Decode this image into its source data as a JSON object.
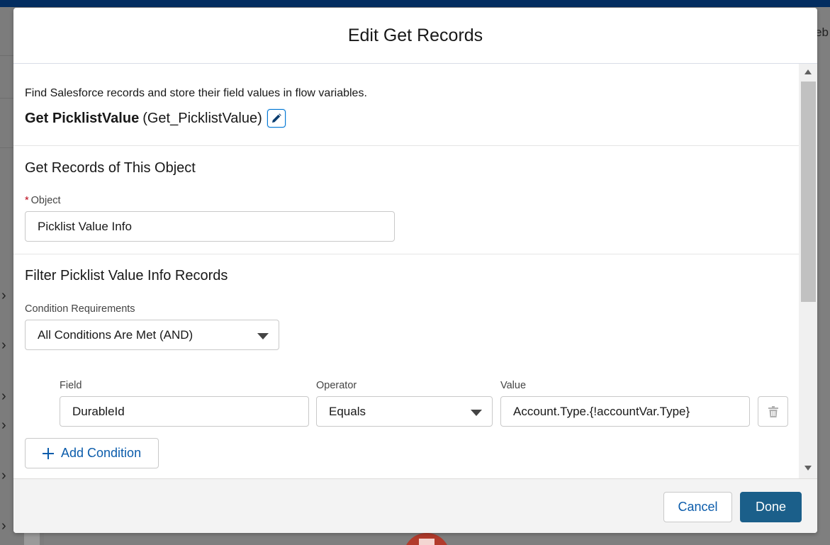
{
  "background": {
    "tab_text": "eb"
  },
  "modal": {
    "title": "Edit Get Records",
    "description": "Find Salesforce records and store their field values in flow variables.",
    "element_label": "Get PicklistValue",
    "element_api_name": "(Get_PicklistValue)",
    "object_section": {
      "title": "Get Records of This Object",
      "required_mark": "*",
      "object_label": "Object",
      "object_value": "Picklist Value Info"
    },
    "filter_section": {
      "title": "Filter Picklist Value Info Records",
      "condition_requirements_label": "Condition Requirements",
      "condition_requirements_value": "All Conditions Are Met (AND)",
      "columns": {
        "field": "Field",
        "operator": "Operator",
        "value": "Value"
      },
      "conditions": [
        {
          "field": "DurableId",
          "operator": "Equals",
          "value": "Account.Type.{!accountVar.Type}"
        }
      ],
      "add_condition_label": "Add Condition"
    },
    "footer": {
      "cancel_label": "Cancel",
      "done_label": "Done"
    }
  },
  "icons": {
    "edit": "pencil-icon",
    "delete": "trash-icon",
    "add": "plus-icon",
    "dropdown": "caret-down-icon"
  },
  "colors": {
    "brand_blue": "#0176d3",
    "link_blue": "#0b5cab",
    "primary_button": "#1b5f8a",
    "required": "#ba0517",
    "top_bar": "#032d60"
  }
}
